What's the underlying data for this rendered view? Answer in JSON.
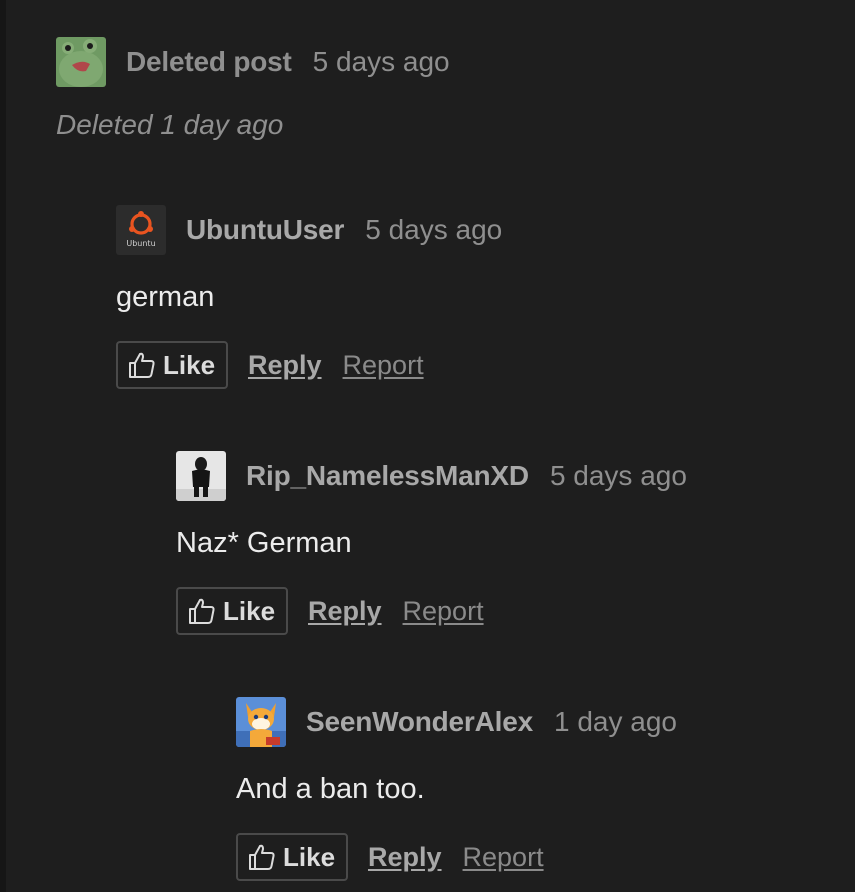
{
  "comments": [
    {
      "author": "Deleted post",
      "time": "5 days ago",
      "deleted_note": "Deleted 1 day ago",
      "avatar_icon": "frog-avatar-icon"
    },
    {
      "author": "UbuntuUser",
      "time": "5 days ago",
      "body": "german",
      "avatar_icon": "ubuntu-avatar-icon",
      "avatar_label": "Ubuntu",
      "like_label": "Like",
      "reply_label": "Reply",
      "report_label": "Report"
    },
    {
      "author": "Rip_NamelessManXD",
      "time": "5 days ago",
      "body": "Naz* German",
      "avatar_icon": "hooded-figure-avatar-icon",
      "like_label": "Like",
      "reply_label": "Reply",
      "report_label": "Report"
    },
    {
      "author": "SeenWonderAlex",
      "time": "1 day ago",
      "body": "And a ban too.",
      "avatar_icon": "fox-character-avatar-icon",
      "like_label": "Like",
      "reply_label": "Reply",
      "report_label": "Report"
    }
  ],
  "colors": {
    "background": "#1e1e1e",
    "username": "#a8a8a8",
    "meta": "#8f8f8f",
    "body": "#ececec",
    "ubuntu_orange": "#e95420"
  }
}
